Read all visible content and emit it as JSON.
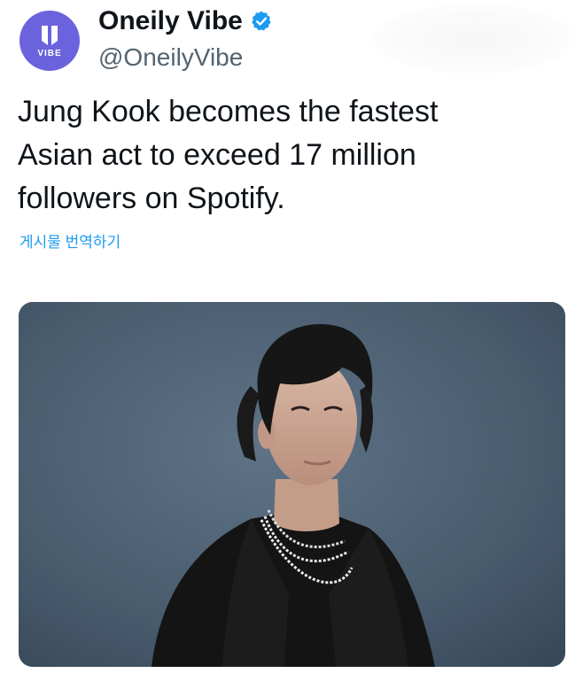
{
  "account": {
    "display_name": "Oneily Vibe",
    "handle": "@OneilyVibe",
    "avatar_text": "VIBE",
    "avatar_color": "#6b63dd",
    "verified": true,
    "verified_color": "#1d9bf0"
  },
  "tweet": {
    "text_lines": [
      "Jung Kook becomes the fastest",
      "Asian act to exceed 17 million",
      "followers on Spotify."
    ],
    "translate_label": "게시물 번역하기"
  },
  "media": {
    "icon": "portrait-photo",
    "background_color": "#4f6375"
  }
}
